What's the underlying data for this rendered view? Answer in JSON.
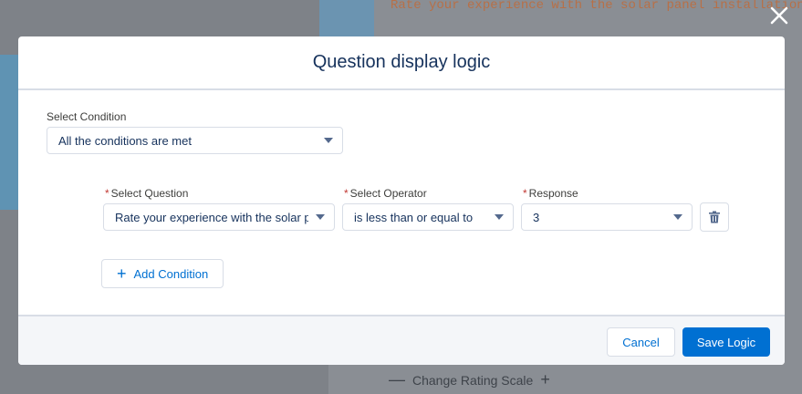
{
  "background": {
    "question_text": "Rate your experience with the solar panel installation",
    "rating_scale_label": "Change Rating Scale",
    "minus": "—",
    "plus": "+"
  },
  "modal": {
    "title": "Question display logic",
    "select_condition": {
      "label": "Select Condition",
      "value": "All the conditions are met"
    },
    "condition_row": {
      "question": {
        "label": "Select Question",
        "value": "Rate your experience with the solar panel installation"
      },
      "operator": {
        "label": "Select Operator",
        "value": "is less than or equal to"
      },
      "response": {
        "label": "Response",
        "value": "3"
      },
      "required_marker": "*"
    },
    "add_condition_label": "Add Condition",
    "add_condition_icon": "+",
    "footer": {
      "cancel_label": "Cancel",
      "save_label": "Save Logic"
    }
  },
  "colors": {
    "brand": "#0070d2",
    "required": "#c23934",
    "title": "#16325c"
  },
  "icons": {
    "close": "close-icon",
    "delete": "trash-icon",
    "dropdown": "chevron-down-icon",
    "add": "plus-icon"
  }
}
